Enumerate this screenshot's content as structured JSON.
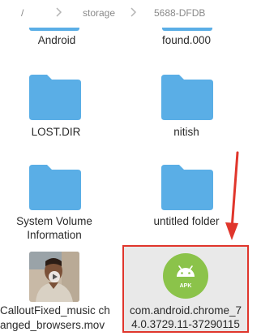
{
  "breadcrumb": {
    "root": "/",
    "segments": [
      "storage",
      "5688-DFDB"
    ]
  },
  "items": [
    {
      "name": "Android"
    },
    {
      "name": "found.000"
    },
    {
      "name": "LOST.DIR"
    },
    {
      "name": "nitish"
    },
    {
      "name": "System Volume\nInformation"
    },
    {
      "name": "untitled folder"
    },
    {
      "name_line1": "CalloutFixed_music ch",
      "name_line2": "anged_browsers.mov"
    },
    {
      "name_line1": "com.android.chrome_7",
      "name_line2": "4.0.3729.11-37290115",
      "badge": "APK"
    }
  ],
  "colors": {
    "folder": "#5aaee6",
    "highlight_border": "#e0362c",
    "apk_green": "#8bc34a"
  }
}
